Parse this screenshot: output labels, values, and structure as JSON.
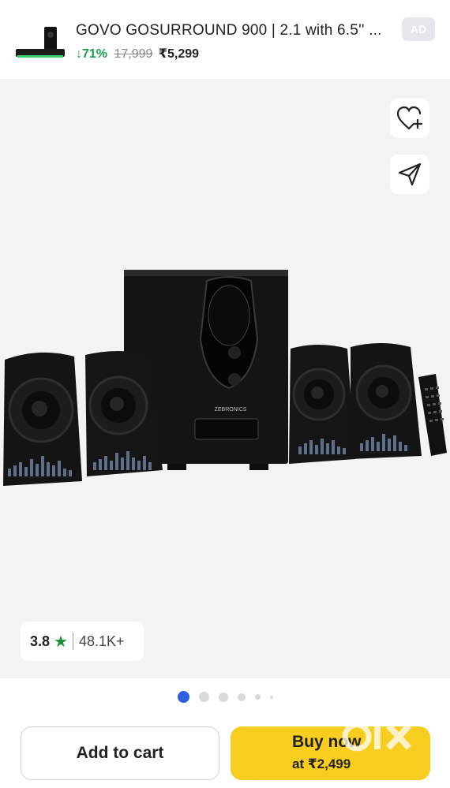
{
  "ad": {
    "title": "GOVO GOSURROUND 900 | 2.1 with 6.5'' ...",
    "discount": "↓71%",
    "mrp": "17,999",
    "price": "₹5,299",
    "badge": "AD",
    "thumb_icon": "soundbar-thumbnail"
  },
  "product": {
    "image_icon": "speaker-system-image",
    "brand_mark": "ZEBRONICS"
  },
  "actions": {
    "wishlist_icon": "heart-plus-icon",
    "share_icon": "send-icon"
  },
  "rating": {
    "value": "3.8",
    "star": "★",
    "count": "48.1K+"
  },
  "pagination": {
    "total": 6,
    "active": 0
  },
  "buttons": {
    "add_to_cart": "Add to cart",
    "buy_now": "Buy now",
    "buy_price": "at ₹2,499"
  },
  "watermark": "olx",
  "colors": {
    "accent_yellow": "#f7ce1f",
    "discount_green": "#1a9e4b",
    "active_dot": "#2f5ee0",
    "star_green": "#1a8f3c"
  }
}
